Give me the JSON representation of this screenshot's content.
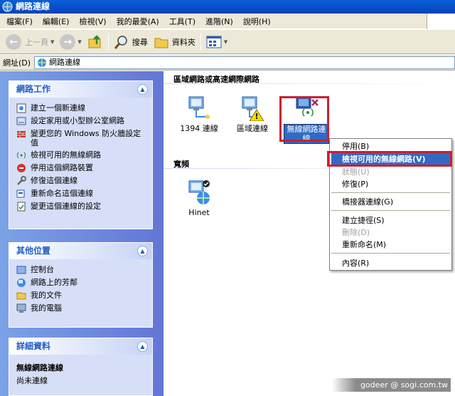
{
  "window": {
    "title": "網路連線"
  },
  "menu": [
    "檔案(F)",
    "編輯(E)",
    "檢視(V)",
    "我的最愛(A)",
    "工具(T)",
    "進階(N)",
    "說明(H)"
  ],
  "toolbar": {
    "back": "上一頁",
    "search": "搜尋",
    "folders": "資料夾"
  },
  "address": {
    "label": "網址(D)",
    "value": "網路連線"
  },
  "left": {
    "tasks": {
      "title": "網路工作",
      "items": [
        "建立一個新連線",
        "設定家用或小型辦公室網路",
        "變更您的 Windows 防火牆設定值",
        "檢視可用的無線網路",
        "停用這個網路裝置",
        "修復這個連線",
        "重新命名這個連線",
        "變更這個連線的設定"
      ]
    },
    "places": {
      "title": "其他位置",
      "items": [
        "控制台",
        "網路上的芳鄰",
        "我的文件",
        "我的電腦"
      ]
    },
    "details": {
      "title": "詳細資料",
      "name": "無線網路連線",
      "status": "尚未連線"
    }
  },
  "right": {
    "lan_header": "區域網路或高速網際網路",
    "lan_items": [
      "1394 連線",
      "區域連線",
      "無線網路連線"
    ],
    "broadband_header": "寬頻",
    "broadband_items": [
      "Hinet"
    ]
  },
  "context_menu": {
    "items": [
      "停用(B)",
      "檢視可用的無線網路(V)",
      "狀態(U)",
      "修復(P)",
      "橋接器連線(G)",
      "建立捷徑(S)",
      "刪除(D)",
      "重新命名(M)",
      "內容(R)"
    ]
  },
  "watermark": "godeer  @ sogi.com.tw",
  "colors": {
    "title": "#0842b8",
    "pane": "#6375d6",
    "highlight": "#316ac5",
    "annotation": "#cc1f2f"
  }
}
